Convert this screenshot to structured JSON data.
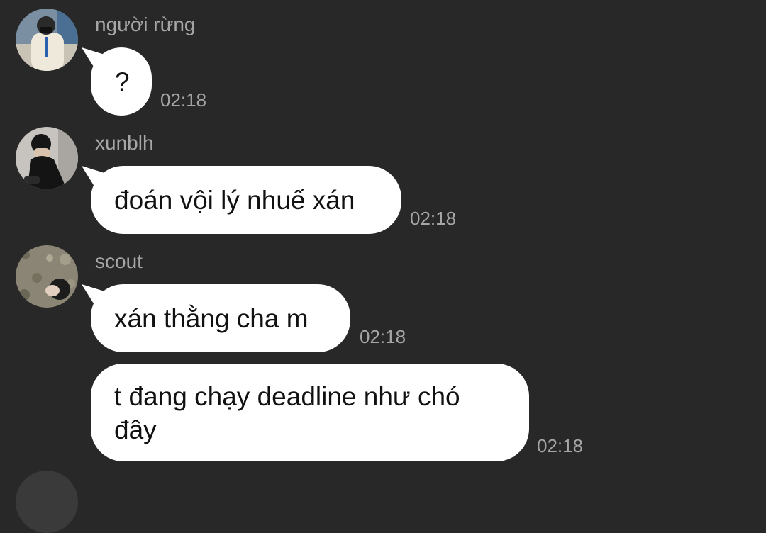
{
  "messages": [
    {
      "sender": "người rừng",
      "avatar_icon": "user-avatar-icon",
      "text": "?",
      "time": "02:18"
    },
    {
      "sender": "xunblh",
      "avatar_icon": "user-avatar-icon",
      "text": "đoán vội lý nhuế xán",
      "time": "02:18"
    },
    {
      "sender": "scout",
      "avatar_icon": "user-avatar-icon",
      "text": "xán thằng cha m",
      "time": "02:18"
    },
    {
      "sender": "",
      "text": "t đang chạy deadline như chó đây",
      "time": "02:18"
    }
  ],
  "theme": {
    "background": "#282828",
    "bubble": "#ffffff",
    "meta_text": "#a6a6a6"
  }
}
